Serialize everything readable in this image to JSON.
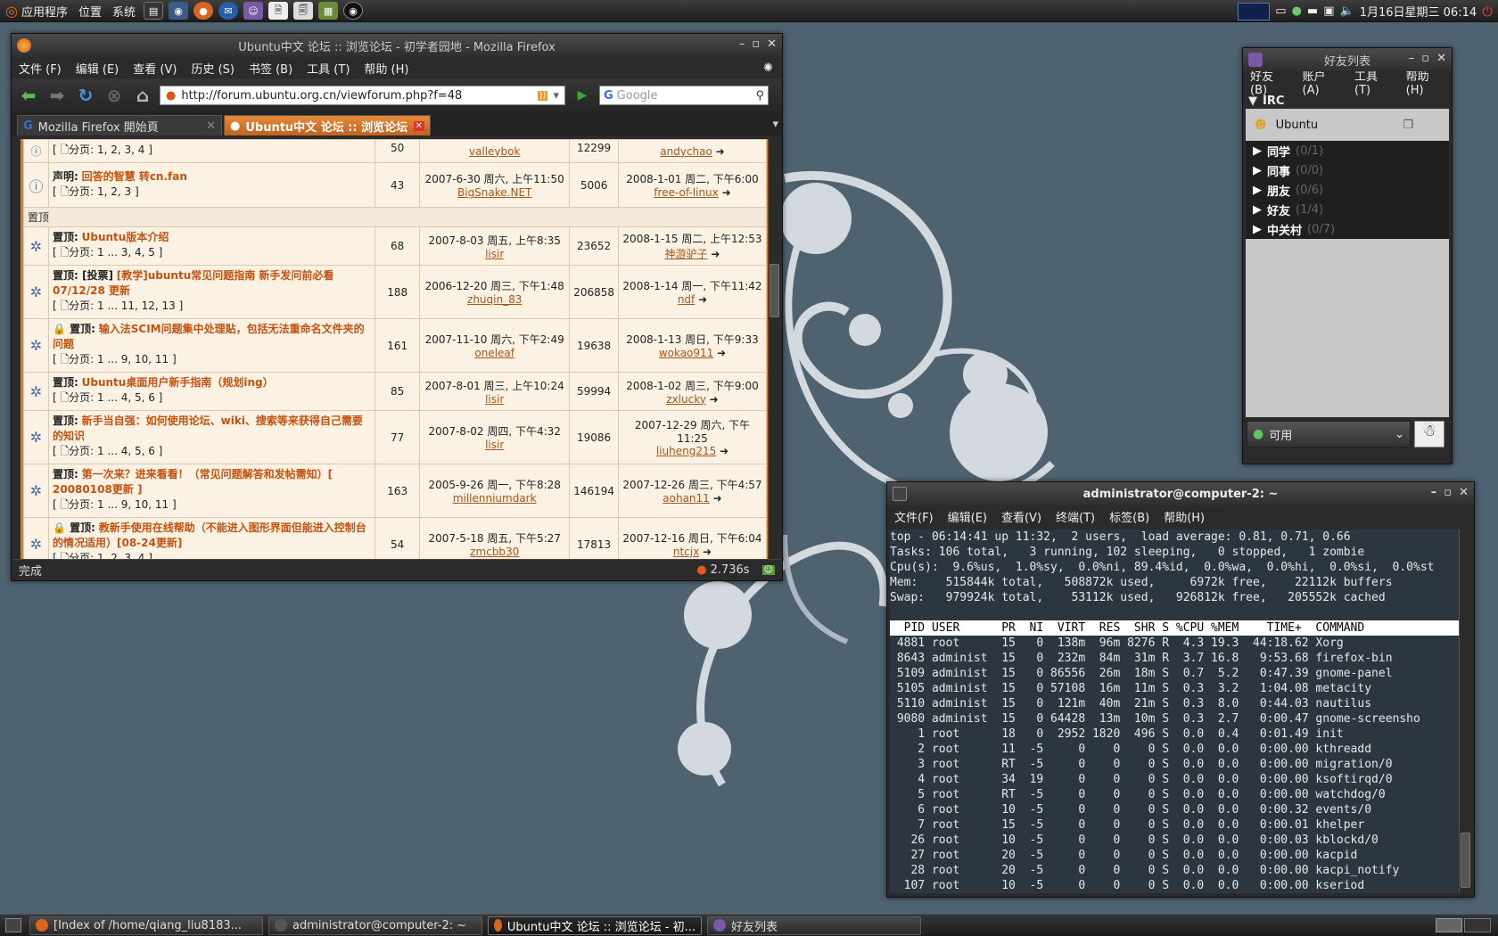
{
  "top_panel": {
    "menus": [
      "应用程序",
      "位置",
      "系统"
    ],
    "clock": "1月16日星期三 06:14"
  },
  "bottom_panel": {
    "tasks": [
      {
        "label": "[Index of /home/qiang_liu8183...",
        "active": false
      },
      {
        "label": "administrator@computer-2: ~",
        "active": false
      },
      {
        "label": "Ubuntu中文 论坛 :: 浏览论坛 - 初...",
        "active": true
      },
      {
        "label": "好友列表",
        "active": false
      }
    ]
  },
  "firefox": {
    "title": "Ubuntu中文 论坛 :: 浏览论坛 - 初学者园地 - Mozilla Firefox",
    "menus": [
      "文件 (F)",
      "编辑 (E)",
      "查看 (V)",
      "历史 (S)",
      "书签 (B)",
      "工具 (T)",
      "帮助 (H)"
    ],
    "url": "http://forum.ubuntu.org.cn/viewforum.php?f=48",
    "search_placeholder": "Google",
    "tabs": [
      {
        "label": "Mozilla Firefox 開始頁",
        "active": false
      },
      {
        "label": "Ubuntu中文 论坛 :: 浏览论坛 ...",
        "active": true
      }
    ],
    "status": "完成",
    "timer": "2.736s"
  },
  "forum": {
    "partial_row": {
      "pages": "[ 🗋分页: 1, 2, 3, 4 ]",
      "replies": "50",
      "author": "valleybok",
      "views": "12299",
      "last_author": "andychao"
    },
    "announce_row": {
      "prefix": "声明:",
      "title": "回答的智慧 转cn.fan",
      "pages": "[ 🗋分页: 1, 2, 3 ]",
      "replies": "43",
      "date": "2007-6-30 周六, 上午11:50",
      "author": "BigSnake.NET",
      "views": "5006",
      "last_date": "2008-1-01 周二, 下午6:00",
      "last_author": "free-of-linux"
    },
    "section_label": "置顶",
    "rows": [
      {
        "prefix": "置顶:",
        "title": "Ubuntu版本介绍",
        "pages": "[ 🗋分页: 1 ... 3, 4, 5 ]",
        "replies": "68",
        "date": "2007-8-03 周五, 上午8:35",
        "author": "lisir",
        "views": "23652",
        "last_date": "2008-1-15 周二, 上午12:53",
        "last_author": "神游驴子"
      },
      {
        "prefix": "置顶: [投票]",
        "title": "[教学]ubuntu常见问题指南 新手发问前必看 07/12/28 更新",
        "pages": "[ 🗋分页: 1 ... 11, 12, 13 ]",
        "replies": "188",
        "date": "2006-12-20 周三, 下午1:48",
        "author": "zhuqin_83",
        "views": "206858",
        "last_date": "2008-1-14 周一, 下午11:42",
        "last_author": "ndf"
      },
      {
        "prefix": "🔒 置顶:",
        "title": "输入法SCIM问题集中处理贴，包括无法重命名文件夹的问题",
        "pages": "[ 🗋分页: 1 ... 9, 10, 11 ]",
        "replies": "161",
        "date": "2007-11-10 周六, 下午2:49",
        "author": "oneleaf",
        "views": "19638",
        "last_date": "2008-1-13 周日, 下午9:33",
        "last_author": "wokao911"
      },
      {
        "prefix": "置顶:",
        "title": "Ubuntu桌面用户新手指南（规划ing）",
        "pages": "[ 🗋分页: 1 ... 4, 5, 6 ]",
        "replies": "85",
        "date": "2007-8-01 周三, 上午10:24",
        "author": "lisir",
        "views": "59994",
        "last_date": "2008-1-02 周三, 下午9:00",
        "last_author": "zxlucky"
      },
      {
        "prefix": "置顶:",
        "title": "新手当自强：如何使用论坛、wiki、搜索等来获得自己需要的知识",
        "pages": "[ 🗋分页: 1 ... 4, 5, 6 ]",
        "replies": "77",
        "date": "2007-8-02 周四, 下午4:32",
        "author": "lisir",
        "views": "19086",
        "last_date": "2007-12-29 周六, 下午11:25",
        "last_author": "liuheng215"
      },
      {
        "prefix": "置顶:",
        "title": "第一次来？进来看看！（常见问题解答和发帖需知）[ 20080108更新 ]",
        "pages": "[ 🗋分页: 1 ... 9, 10, 11 ]",
        "replies": "163",
        "date": "2005-9-26 周一, 下午8:28",
        "author": "millenniumdark",
        "views": "146194",
        "last_date": "2007-12-26 周三, 下午4:57",
        "last_author": "aohan11"
      },
      {
        "prefix": "🔒 置顶:",
        "title": "教新手使用在线帮助（不能进入图形界面但能进入控制台的情况适用）[08-24更新]",
        "pages": "[ 🗋分页: 1, 2, 3, 4 ]",
        "replies": "54",
        "date": "2007-5-18 周五, 下午5:27",
        "author": "zmcbb30",
        "views": "17813",
        "last_date": "2007-12-16 周日, 下午6:04",
        "last_author": "ntcjx"
      }
    ]
  },
  "pidgin": {
    "title": "好友列表",
    "menus": [
      "好友(B)",
      "账户(A)",
      "工具(T)",
      "帮助(H)"
    ],
    "irc_label": "IRC",
    "selected": "Ubuntu",
    "groups": [
      {
        "name": "同学",
        "count": "(0/1)"
      },
      {
        "name": "同事",
        "count": "(0/0)"
      },
      {
        "name": "朋友",
        "count": "(0/6)"
      },
      {
        "name": "好友",
        "count": "(1/4)"
      },
      {
        "name": "中关村",
        "count": "(0/7)"
      }
    ],
    "status": "可用"
  },
  "terminal": {
    "title": "administrator@computer-2: ~",
    "menus": [
      "文件(F)",
      "编辑(E)",
      "查看(V)",
      "终端(T)",
      "标签(B)",
      "帮助(H)"
    ],
    "summary": [
      "top - 06:14:41 up 11:32,  2 users,  load average: 0.81, 0.71, 0.66",
      "Tasks: 106 total,   3 running, 102 sleeping,   0 stopped,   1 zombie",
      "Cpu(s):  9.6%us,  1.0%sy,  0.0%ni, 89.4%id,  0.0%wa,  0.0%hi,  0.0%si,  0.0%st",
      "Mem:    515844k total,   508872k used,     6972k free,    22112k buffers",
      "Swap:   979924k total,    53112k used,   926812k free,   205552k cached",
      ""
    ],
    "header": "  PID USER      PR  NI  VIRT  RES  SHR S %CPU %MEM    TIME+  COMMAND         ",
    "processes": [
      " 4881 root      15   0  138m  96m 8276 R  4.3 19.3  44:18.62 Xorg",
      " 8643 administ  15   0  232m  84m  31m R  3.7 16.8   9:53.68 firefox-bin",
      " 5109 administ  15   0 86556  26m  18m S  0.7  5.2   0:47.39 gnome-panel",
      " 5105 administ  15   0 57108  16m  11m S  0.3  3.2   1:04.08 metacity",
      " 5110 administ  15   0  121m  40m  21m S  0.3  8.0   0:44.03 nautilus",
      " 9080 administ  15   0 64428  13m  10m S  0.3  2.7   0:00.47 gnome-screensho",
      "    1 root      18   0  2952 1820  496 S  0.0  0.4   0:01.49 init",
      "    2 root      11  -5     0    0    0 S  0.0  0.0   0:00.00 kthreadd",
      "    3 root      RT  -5     0    0    0 S  0.0  0.0   0:00.00 migration/0",
      "    4 root      34  19     0    0    0 S  0.0  0.0   0:00.00 ksoftirqd/0",
      "    5 root      RT  -5     0    0    0 S  0.0  0.0   0:00.00 watchdog/0",
      "    6 root      10  -5     0    0    0 S  0.0  0.0   0:00.32 events/0",
      "    7 root      15  -5     0    0    0 S  0.0  0.0   0:00.01 khelper",
      "   26 root      10  -5     0    0    0 S  0.0  0.0   0:00.03 kblockd/0",
      "   27 root      20  -5     0    0    0 S  0.0  0.0   0:00.00 kacpid",
      "   28 root      20  -5     0    0    0 S  0.0  0.0   0:00.00 kacpi_notify",
      "  107 root      10  -5     0    0    0 S  0.0  0.0   0:00.00 kseriod"
    ]
  }
}
